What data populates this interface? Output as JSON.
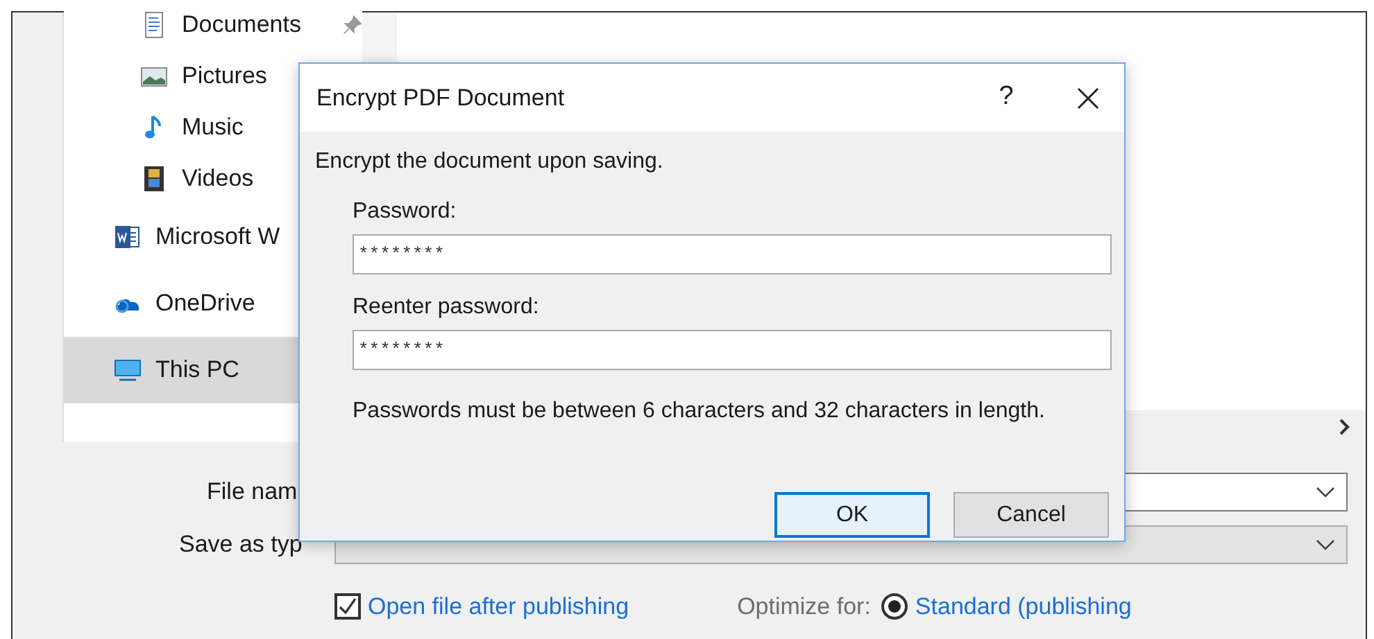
{
  "nav_pane": {
    "items": [
      {
        "label": "Documents",
        "kind": "library",
        "pinned": true,
        "selected": false
      },
      {
        "label": "Pictures",
        "kind": "library",
        "pinned": false,
        "selected": false
      },
      {
        "label": "Music",
        "kind": "library",
        "pinned": false,
        "selected": false
      },
      {
        "label": "Videos",
        "kind": "library",
        "pinned": false,
        "selected": false
      },
      {
        "label": "Microsoft W",
        "kind": "root",
        "pinned": false,
        "selected": false
      },
      {
        "label": "OneDrive",
        "kind": "root",
        "pinned": false,
        "selected": false
      },
      {
        "label": "This PC",
        "kind": "root",
        "pinned": false,
        "selected": true
      }
    ]
  },
  "save_form": {
    "file_name_label": "File nam",
    "save_as_type_label": "Save as typ",
    "open_after": {
      "label": "Open file after publishing",
      "checked": true
    },
    "optimize": {
      "label": "Optimize for:",
      "option": "Standard (publishing",
      "selected": true
    }
  },
  "dialog": {
    "title": "Encrypt PDF Document",
    "help": "?",
    "intro": "Encrypt the document upon saving.",
    "fields": [
      {
        "label": "Password:",
        "value": "********"
      },
      {
        "label": "Reenter password:",
        "value": "********"
      }
    ],
    "note": "Passwords must be between 6 characters and 32 characters in length.",
    "buttons": [
      {
        "label": "OK",
        "default": true
      },
      {
        "label": "Cancel",
        "default": false
      }
    ]
  }
}
